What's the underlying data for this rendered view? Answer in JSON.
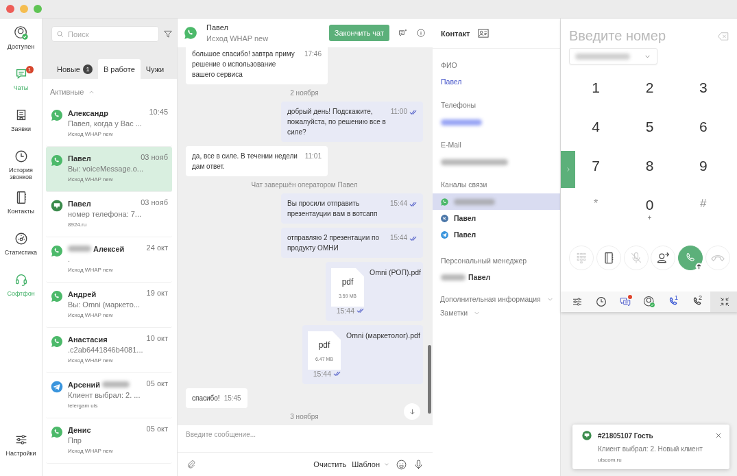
{
  "nav": [
    {
      "kind": "status",
      "label": "Доступен",
      "active": false
    },
    {
      "kind": "chats",
      "label": "Чаты",
      "active": true,
      "badge": "1"
    },
    {
      "kind": "requests",
      "label": "Заявки",
      "active": false
    },
    {
      "kind": "history",
      "label": "История звонков",
      "active": false
    },
    {
      "kind": "contacts",
      "label": "Контакты",
      "active": false
    },
    {
      "kind": "stats",
      "label": "Статистика",
      "active": false
    },
    {
      "kind": "softphone",
      "label": "Софтфон",
      "active": true
    }
  ],
  "settings": {
    "label": "Настройки"
  },
  "chat_list": {
    "search": {
      "placeholder": "Поиск"
    },
    "tabs": [
      {
        "label": "Новые",
        "count": "1",
        "selected": false
      },
      {
        "label": "В работе",
        "selected": true
      },
      {
        "label": "Чужи",
        "selected": false
      }
    ],
    "section": {
      "label": "Активные",
      "expanded": true
    },
    "chats": [
      {
        "kind": "whatsapp",
        "name": "Александр",
        "time": "10:45",
        "preview": "Павел, когда у Вас ...",
        "source": "Исход WHAP new",
        "selected": false
      },
      {
        "kind": "whatsapp",
        "name": "Павел",
        "time": "03 нояб",
        "preview": "Вы: voiceMessage.o...",
        "source": "Исход WHAP new",
        "selected": true
      },
      {
        "kind": "bot",
        "name": "Павел",
        "time": "03 нояб",
        "preview": "номер телефона: 7...",
        "source": "8924.ru",
        "selected": false
      },
      {
        "kind": "whatsapp",
        "name": "Алексей",
        "blurred_before": true,
        "time": "24 окт",
        "preview": ".",
        "source": "Исход WHAP new",
        "selected": false
      },
      {
        "kind": "whatsapp",
        "name": "Андрей",
        "time": "19 окт",
        "preview": "Вы: Omni (маркето...",
        "source": "Исход WHAP new",
        "selected": false
      },
      {
        "kind": "whatsapp",
        "name": "Анастасия",
        "time": "10 окт",
        "preview": ".c2ab6441846b4081...",
        "source": "Исход WHAP new",
        "selected": false
      },
      {
        "kind": "telegram",
        "name": "Арсений",
        "blurred_after": true,
        "time": "05 окт",
        "preview": "Клиент выбрал: 2. ...",
        "source": "telergam uis",
        "selected": false
      },
      {
        "kind": "whatsapp",
        "name": "Денис",
        "time": "05 окт",
        "preview": "Ппр",
        "source": "Исход WHAP new",
        "selected": false
      }
    ]
  },
  "chat": {
    "kind": "whatsapp",
    "name": "Павел",
    "source": "Исход WHAP new",
    "end_button": "Закончить чат",
    "messages": [
      {
        "kind": "in",
        "text": "большое спасибо! завтра приму решение о использование вашего сервиса",
        "time": "17:46"
      },
      {
        "kind": "date",
        "text": "2 ноября"
      },
      {
        "kind": "out",
        "text": "добрый день! Подскажите, пожалуйста, по решению все в силе?",
        "time": "11:00",
        "read": true
      },
      {
        "kind": "in",
        "text": "да, все в силе. В течении недели дам ответ.",
        "time": "11:01"
      },
      {
        "kind": "system",
        "text": "Чат завершён оператором Павел"
      },
      {
        "kind": "out",
        "text": "Вы просили отправить презентауции вам в вотсапп",
        "time": "15:44",
        "read": true
      },
      {
        "kind": "out",
        "text": "отправляю 2 презентации по продукту ОМНИ",
        "time": "15:44",
        "read": true
      },
      {
        "kind": "file",
        "file": "Omni (РОП).pdf",
        "type": "pdf",
        "size": "3.59 MB",
        "time": "15:44",
        "read": true
      },
      {
        "kind": "file",
        "file": "Omni (маркетолог).pdf",
        "type": "pdf",
        "size": "6.47 MB",
        "time": "15:44",
        "read": true
      },
      {
        "kind": "in",
        "text": "спасибо!",
        "time": "15:45"
      },
      {
        "kind": "date",
        "text": "3 ноября"
      }
    ],
    "composer": {
      "placeholder": "Введите сообщение...",
      "clear": "Очистить",
      "template": "Шаблон"
    }
  },
  "contact": {
    "title": "Контакт",
    "fields": [
      {
        "kind": "link",
        "label": "ФИО",
        "value": "Павел"
      },
      {
        "kind": "hidden_link",
        "label": "Телефоны"
      },
      {
        "kind": "hidden",
        "label": "E-Mail"
      }
    ],
    "channels_label": "Каналы связи",
    "channels": [
      {
        "kind": "whatsapp",
        "selected": true
      },
      {
        "kind": "vk",
        "name": "Павел",
        "selected": false
      },
      {
        "kind": "telegram",
        "name": "Павел",
        "selected": false
      }
    ],
    "manager": {
      "label": "Персональный менеджер",
      "name": "Павел"
    },
    "sections": [
      {
        "label": "Дополнительная информация",
        "expanded": false
      },
      {
        "label": "Заметки",
        "expanded": false
      }
    ]
  },
  "dialer": {
    "placeholder": "Введите номер",
    "keys": [
      {
        "digit": "1"
      },
      {
        "digit": "2"
      },
      {
        "digit": "3"
      },
      {
        "digit": "4"
      },
      {
        "digit": "5"
      },
      {
        "digit": "6"
      },
      {
        "digit": "7"
      },
      {
        "digit": "8"
      },
      {
        "digit": "9"
      },
      {
        "digit": "*",
        "dim": true
      },
      {
        "digit": "0",
        "sub": "+"
      },
      {
        "digit": "#",
        "dim": true
      }
    ],
    "actions": [
      {
        "kind": "keypad",
        "disabled": true
      },
      {
        "kind": "contacts",
        "disabled": false
      },
      {
        "kind": "mute",
        "disabled": true
      },
      {
        "kind": "transfer",
        "disabled": false
      },
      {
        "kind": "call",
        "disabled": false
      },
      {
        "kind": "hangup",
        "disabled": true
      }
    ],
    "toolbar": [
      {
        "kind": "settings"
      },
      {
        "kind": "history"
      },
      {
        "kind": "chats",
        "alert": true
      },
      {
        "kind": "status"
      },
      {
        "kind": "line",
        "label": "1",
        "selected": true
      },
      {
        "kind": "line",
        "label": "2",
        "selected": false
      },
      {
        "kind": "collapse"
      }
    ]
  },
  "toast": {
    "kind": "bot",
    "title": "#21805107 Гость",
    "text": "Клиент выбрал: 2. Новый клиент",
    "source": "uiscom.ru"
  }
}
